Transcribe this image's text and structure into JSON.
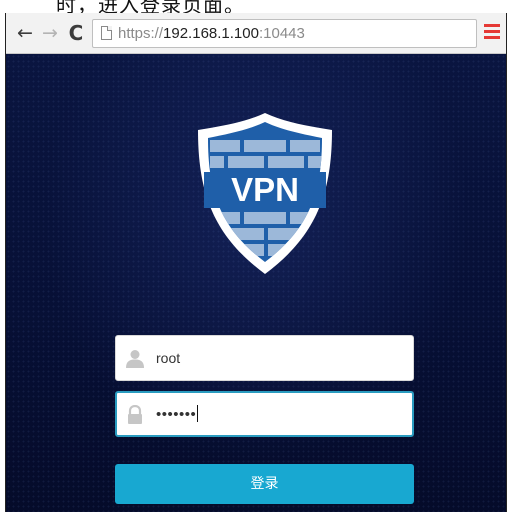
{
  "caption": {
    "text": "时，进入登录页面。"
  },
  "browser": {
    "back_icon": "←",
    "forward_icon": "→",
    "reload_icon": "C",
    "url_scheme": "https://",
    "url_host": "192.168.1.100",
    "url_port": ":10443",
    "menu_icon": "hamburger-menu-icon"
  },
  "logo": {
    "text": "VPN"
  },
  "login": {
    "username_value": "root",
    "password_value": "•••••••",
    "submit_label": "登录"
  },
  "colors": {
    "background": "#071036",
    "button": "#18a8d1",
    "focus_border": "#2a9cc0",
    "shield": "#1f5fa9"
  }
}
